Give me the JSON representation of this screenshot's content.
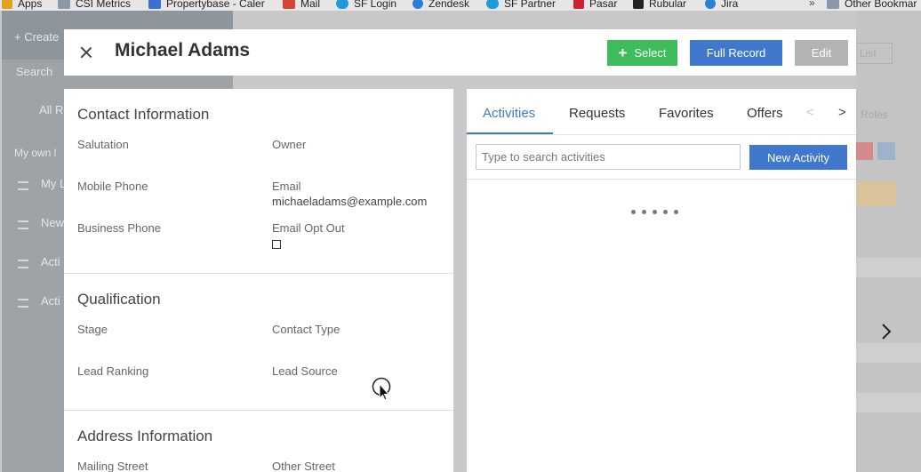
{
  "bookmarks": [
    {
      "label": "Apps",
      "icon": "apps-grid-icon",
      "color": "#e0a020"
    },
    {
      "label": "CSI Metrics",
      "icon": "folder-icon",
      "color": "#8a98a8"
    },
    {
      "label": "Propertybase - Caler",
      "icon": "calendar-icon",
      "color": "#3a6fd8"
    },
    {
      "label": "Mail",
      "icon": "gmail-icon",
      "color": "#d44638"
    },
    {
      "label": "SF Login",
      "icon": "salesforce-cloud-icon",
      "color": "#1f9ad6"
    },
    {
      "label": "Zendesk",
      "icon": "zendesk-icon",
      "color": "#2a7fd4"
    },
    {
      "label": "SF Partner",
      "icon": "salesforce-cloud-icon",
      "color": "#1f9ad6"
    },
    {
      "label": "Pasar",
      "icon": "pasar-icon",
      "color": "#cc2233"
    },
    {
      "label": "Rubular",
      "icon": "rubular-icon",
      "color": "#222222"
    },
    {
      "label": "Jira",
      "icon": "jira-icon",
      "color": "#2a7fd4"
    },
    {
      "label": "Other Bookmar",
      "icon": "folder-icon",
      "color": "#8a98a8"
    }
  ],
  "bookmarks_overflow": "»",
  "background_app": {
    "create_label": "Create",
    "search_placeholder": "Search",
    "all_label": "All R",
    "my_own_label": "My own l",
    "nav_items": [
      "My L",
      "New",
      "Acti",
      "Acti"
    ],
    "list_button": "List",
    "roles_label": "Roles"
  },
  "header": {
    "title": "Michael Adams",
    "select_label": "Select",
    "full_record_label": "Full Record",
    "edit_label": "Edit"
  },
  "contact_information": {
    "title": "Contact Information",
    "fields": [
      {
        "label": "Salutation",
        "value": ""
      },
      {
        "label": "Owner",
        "value": ""
      },
      {
        "label": "Mobile Phone",
        "value": ""
      },
      {
        "label": "Email",
        "value": "michaeladams@example.com"
      },
      {
        "label": "Business Phone",
        "value": ""
      },
      {
        "label": "Email Opt Out",
        "value": ""
      }
    ],
    "email_opt_out_checked": false
  },
  "qualification": {
    "title": "Qualification",
    "fields": [
      {
        "label": "Stage"
      },
      {
        "label": "Contact Type"
      },
      {
        "label": "Lead Ranking"
      },
      {
        "label": "Lead Source"
      }
    ]
  },
  "address_information": {
    "title": "Address Information",
    "fields": [
      {
        "label": "Mailing Street"
      },
      {
        "label": "Other Street"
      }
    ]
  },
  "activity_panel": {
    "tabs": [
      "Activities",
      "Requests",
      "Favorites",
      "Offers"
    ],
    "active_tab": "Activities",
    "prev_label": "<",
    "next_label": ">",
    "search_placeholder": "Type to search activities",
    "new_activity_label": "New Activity"
  },
  "colors": {
    "accent": "#3f78cc",
    "select_green": "#3cbc5b",
    "edit_disabled": "#b3b3b3"
  }
}
